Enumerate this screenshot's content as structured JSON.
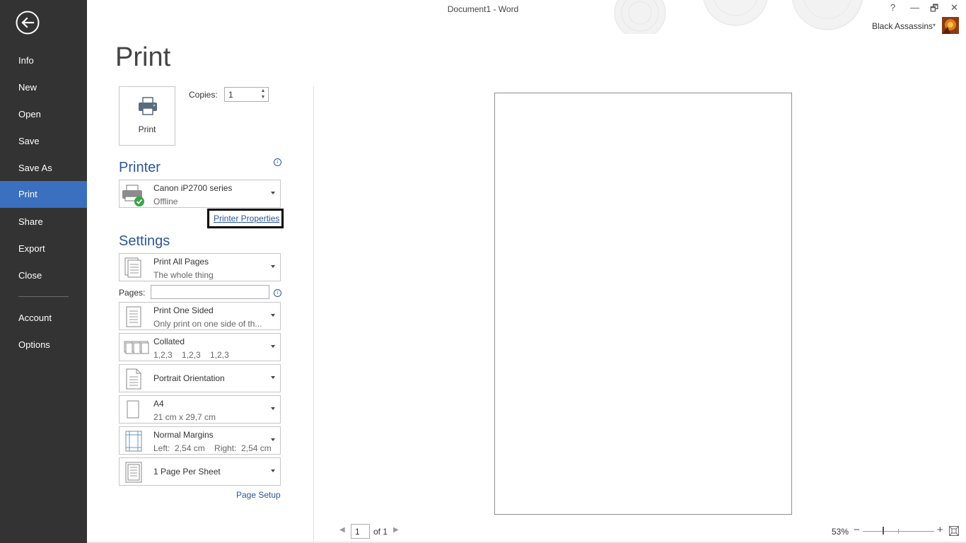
{
  "window": {
    "title": "Document1 - Word",
    "help": "?",
    "minimize": "—",
    "restore": "🗗",
    "close": "✕",
    "user": "Black Assassins",
    "user_caret": "▾"
  },
  "sidebar": {
    "items": [
      {
        "label": "Info"
      },
      {
        "label": "New"
      },
      {
        "label": "Open"
      },
      {
        "label": "Save"
      },
      {
        "label": "Save As"
      },
      {
        "label": "Print"
      },
      {
        "label": "Share"
      },
      {
        "label": "Export"
      },
      {
        "label": "Close"
      },
      {
        "label": "Account"
      },
      {
        "label": "Options"
      }
    ],
    "active": "Print"
  },
  "print": {
    "heading": "Print",
    "button_label": "Print",
    "copies_label": "Copies:",
    "copies_value": "1"
  },
  "printer": {
    "heading": "Printer",
    "info": "i",
    "name": "Canon iP2700 series",
    "status": "Offline",
    "properties_link": "Printer Properties"
  },
  "settings": {
    "heading": "Settings",
    "print_range": {
      "title": "Print All Pages",
      "subtitle": "The whole thing"
    },
    "pages_label": "Pages:",
    "pages_value": "",
    "sides": {
      "title": "Print One Sided",
      "subtitle": "Only print on one side of th..."
    },
    "collation": {
      "title": "Collated",
      "subtitle": "1,2,3    1,2,3    1,2,3"
    },
    "orientation": {
      "title": "Portrait Orientation"
    },
    "paper": {
      "title": "A4",
      "subtitle": "21 cm x 29,7 cm"
    },
    "margins": {
      "title": "Normal Margins",
      "subtitle": "Left:  2,54 cm    Right:  2,54 cm"
    },
    "per_sheet": {
      "title": "1 Page Per Sheet"
    },
    "page_setup_link": "Page Setup"
  },
  "preview": {
    "page_current": "1",
    "page_of": "of 1",
    "prev": "◀",
    "next": "▶",
    "zoom": "53%",
    "zoom_minus": "−",
    "zoom_plus": "+"
  },
  "colors": {
    "sidebar_bg": "#333333",
    "sidebar_active": "#3b6fbf",
    "accent": "#2b579a"
  }
}
